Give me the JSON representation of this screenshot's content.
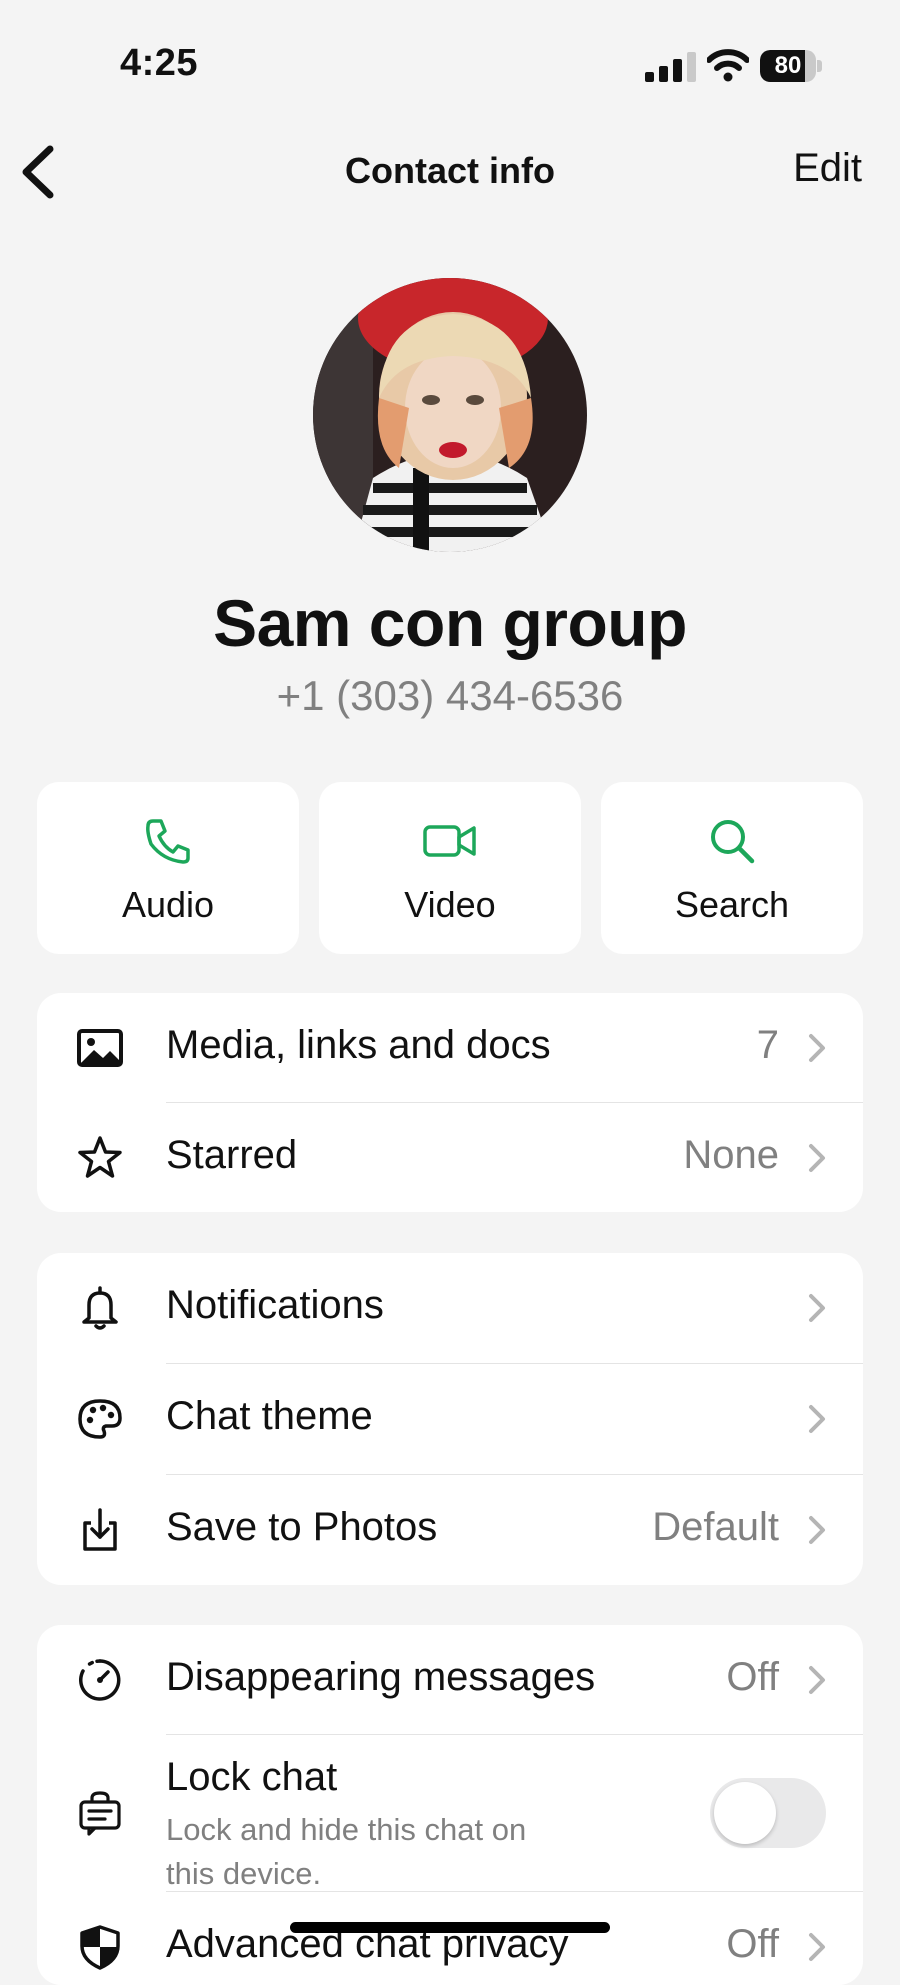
{
  "status_bar": {
    "time": "4:25",
    "battery_level": 80,
    "battery_label": "80"
  },
  "nav": {
    "title": "Contact info",
    "edit_label": "Edit",
    "back_icon": "chevron-left-icon"
  },
  "contact": {
    "name": "Sam con group",
    "phone": "+1 (303) 434-6536"
  },
  "actions": [
    {
      "label": "Audio",
      "icon": "phone-icon"
    },
    {
      "label": "Video",
      "icon": "video-icon"
    },
    {
      "label": "Search",
      "icon": "search-icon"
    }
  ],
  "media_card": {
    "rows": [
      {
        "label": "Media, links and docs",
        "value": "7",
        "icon": "image-icon"
      },
      {
        "label": "Starred",
        "value": "None",
        "icon": "star-icon"
      }
    ]
  },
  "settings_card": {
    "rows": [
      {
        "label": "Notifications",
        "value": "",
        "icon": "bell-icon"
      },
      {
        "label": "Chat theme",
        "value": "",
        "icon": "palette-icon"
      },
      {
        "label": "Save to Photos",
        "value": "Default",
        "icon": "download-icon"
      }
    ]
  },
  "privacy_card": {
    "disappearing": {
      "label": "Disappearing messages",
      "value": "Off",
      "icon": "timer-icon"
    },
    "lock_chat": {
      "label": "Lock chat",
      "sublabel_line1": "Lock and hide this chat on",
      "sublabel_line2": "this device.",
      "enabled": false,
      "icon": "lock-chat-icon"
    },
    "advanced": {
      "label": "Advanced chat privacy",
      "value": "Off",
      "icon": "shield-icon"
    }
  },
  "colors": {
    "accent_green": "#1da75a",
    "background": "#f4f4f4",
    "secondary_text": "#808080"
  }
}
